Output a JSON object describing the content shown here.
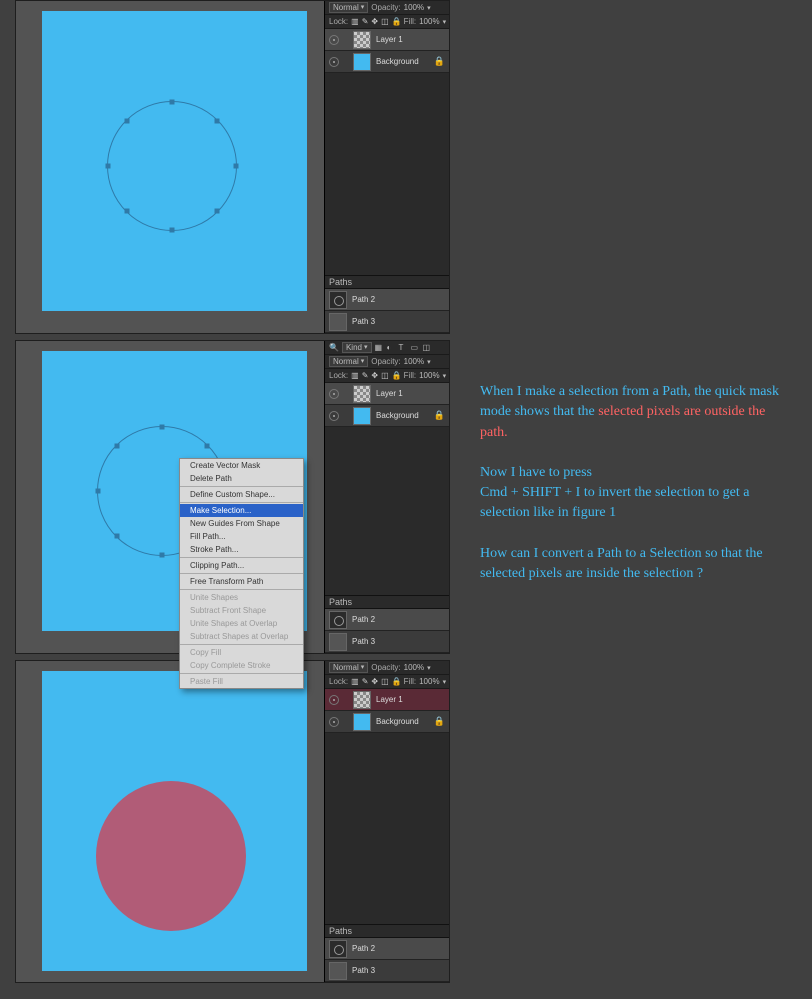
{
  "layersPanel": {
    "filterLabel": "Kind",
    "blendMode": "Normal",
    "opacityLabel": "Opacity:",
    "opacityValue": "100%",
    "lockLabel": "Lock:",
    "fillLabel": "Fill:",
    "fillValue": "100%",
    "layers": [
      {
        "name": "Layer 1"
      },
      {
        "name": "Background"
      }
    ],
    "pathsTitle": "Paths",
    "paths": [
      {
        "name": "Path 2"
      },
      {
        "name": "Path 3"
      }
    ]
  },
  "contextMenu": {
    "items": [
      {
        "label": "Create Vector Mask",
        "enabled": true
      },
      {
        "label": "Delete Path",
        "enabled": true
      },
      {
        "sep": true
      },
      {
        "label": "Define Custom Shape...",
        "enabled": true
      },
      {
        "sep": true
      },
      {
        "label": "Make Selection...",
        "enabled": true,
        "hi": true
      },
      {
        "label": "New Guides From Shape",
        "enabled": true
      },
      {
        "label": "Fill Path...",
        "enabled": true
      },
      {
        "label": "Stroke Path...",
        "enabled": true
      },
      {
        "sep": true
      },
      {
        "label": "Clipping Path...",
        "enabled": true
      },
      {
        "sep": true
      },
      {
        "label": "Free Transform Path",
        "enabled": true
      },
      {
        "sep": true
      },
      {
        "label": "Unite Shapes",
        "enabled": false
      },
      {
        "label": "Subtract Front Shape",
        "enabled": false
      },
      {
        "label": "Unite Shapes at Overlap",
        "enabled": false
      },
      {
        "label": "Subtract Shapes at Overlap",
        "enabled": false
      },
      {
        "sep": true
      },
      {
        "label": "Copy Fill",
        "enabled": false
      },
      {
        "label": "Copy Complete Stroke",
        "enabled": false
      },
      {
        "sep": true
      },
      {
        "label": "Paste Fill",
        "enabled": false
      }
    ]
  },
  "explain": {
    "p1a": "When I make a selection from a Path, the quick mask mode shows that the ",
    "p1b": "selected pixels are outside the path.",
    "p2a": "Now I have to press",
    "p2b": "Cmd + SHIFT + I to invert the selection to get a selection like in figure 1",
    "p3": "How can I convert a Path to a Selection so that the selected pixels are inside the selection ?"
  }
}
